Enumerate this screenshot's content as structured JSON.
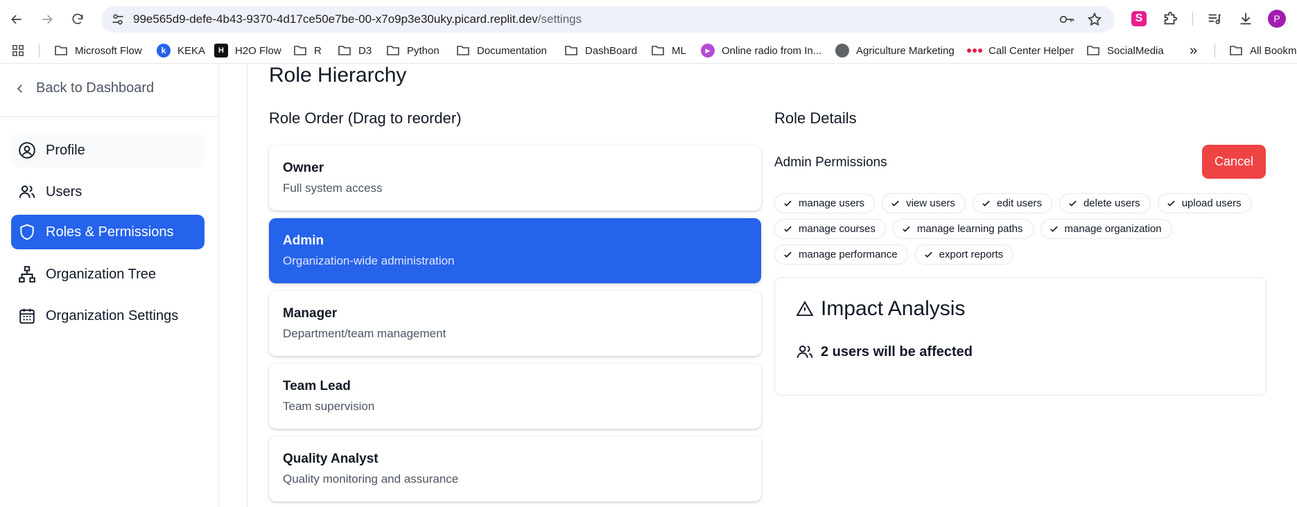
{
  "browser": {
    "url_host": "99e565d9-defe-4b43-9370-4d17ce50e7be-00-x7o9p3e30uky.picard.replit.dev",
    "url_path": "/settings",
    "extension_letter": "S",
    "profile_initial": "P",
    "bookmarks": [
      {
        "label": "Microsoft Flow",
        "icon": "folder-icon"
      },
      {
        "label": "KEKA",
        "icon": "keka-icon",
        "glyph": "k"
      },
      {
        "label": "H2O Flow",
        "icon": "h2o-icon",
        "glyph": "H"
      },
      {
        "label": "R",
        "icon": "folder-icon"
      },
      {
        "label": "D3",
        "icon": "folder-icon"
      },
      {
        "label": "Python",
        "icon": "folder-icon"
      },
      {
        "label": "Documentation",
        "icon": "folder-icon"
      },
      {
        "label": "DashBoard",
        "icon": "folder-icon"
      },
      {
        "label": "ML",
        "icon": "folder-icon"
      },
      {
        "label": "Online radio from In...",
        "icon": "radio-icon"
      },
      {
        "label": "Agriculture Marketing",
        "icon": "globe-icon"
      },
      {
        "label": "Call Center Helper",
        "icon": "cch-icon"
      },
      {
        "label": "SocialMedia",
        "icon": "folder-icon"
      }
    ],
    "overflow_glyph": "»",
    "all_bookmarks_label": "All Bookm"
  },
  "sidebar": {
    "back_label": "Back to Dashboard",
    "items": [
      {
        "label": "Profile",
        "icon": "user-circle-icon"
      },
      {
        "label": "Users",
        "icon": "users-icon"
      },
      {
        "label": "Roles & Permissions",
        "icon": "shield-icon"
      },
      {
        "label": "Organization Tree",
        "icon": "org-tree-icon"
      },
      {
        "label": "Organization Settings",
        "icon": "calendar-icon"
      }
    ],
    "active_index": 2
  },
  "main": {
    "title": "Role Hierarchy",
    "role_order_title": "Role Order (Drag to reorder)",
    "roles": [
      {
        "name": "Owner",
        "description": "Full system access"
      },
      {
        "name": "Admin",
        "description": "Organization-wide administration"
      },
      {
        "name": "Manager",
        "description": "Department/team management"
      },
      {
        "name": "Team Lead",
        "description": "Team supervision"
      },
      {
        "name": "Quality Analyst",
        "description": "Quality monitoring and assurance"
      }
    ],
    "selected_role_index": 1,
    "details": {
      "title": "Role Details",
      "permissions_heading": "Admin Permissions",
      "cancel_label": "Cancel",
      "permissions": [
        [
          "manage users",
          "view users",
          "edit users",
          "delete users",
          "upload users"
        ],
        [
          "manage courses",
          "manage learning paths",
          "manage organization"
        ],
        [
          "manage performance",
          "export reports"
        ]
      ],
      "impact": {
        "title": "Impact Analysis",
        "affected_text": "2 users will be affected"
      }
    }
  },
  "colors": {
    "primary": "#2563eb",
    "danger": "#ef4444"
  }
}
